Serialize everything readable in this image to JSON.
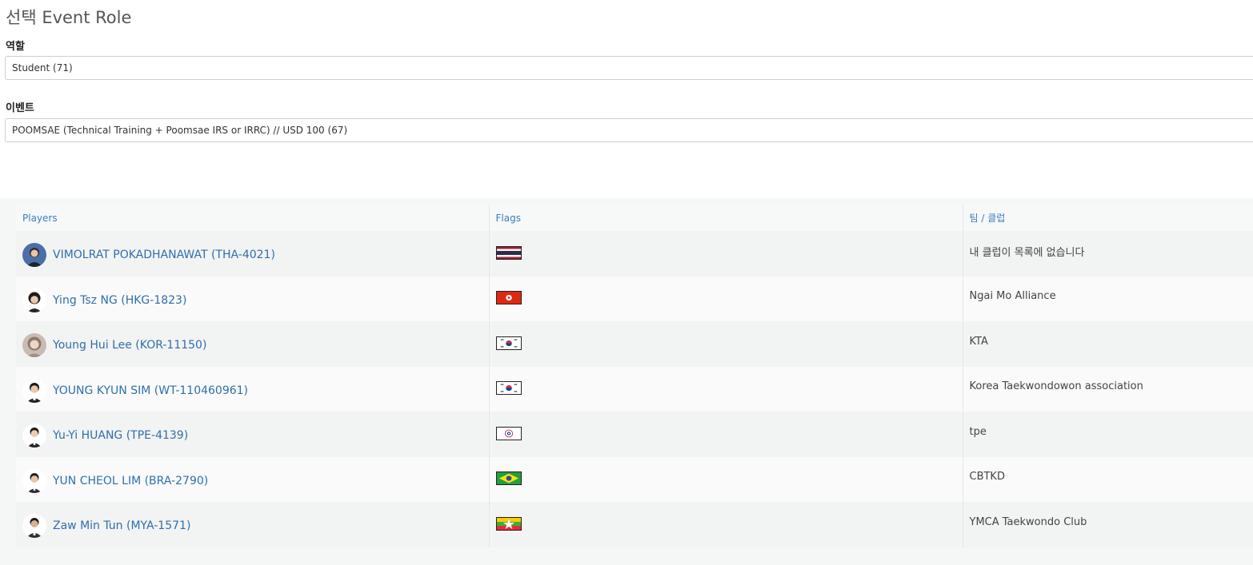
{
  "page": {
    "title": "선택 Event Role"
  },
  "form": {
    "role_label": "역할",
    "role_value": "Student (71)",
    "event_label": "이벤트",
    "event_value": "POOMSAE (Technical Training + Poomsae IRS or IRRC) // USD 100 (67)"
  },
  "table": {
    "headers": [
      "Players",
      "Flags",
      "팀 / 클럽"
    ],
    "rows": [
      {
        "player": "VIMOLRAT POKADHANAWAT (THA-4021)",
        "flag": "thailand-flag",
        "team": "내 클럽이 목록에 없습니다"
      },
      {
        "player": "Ying Tsz NG (HKG-1823)",
        "flag": "hong-kong-flag",
        "team": "Ngai Mo Alliance"
      },
      {
        "player": "Young Hui Lee (KOR-11150)",
        "flag": "south-korea-flag",
        "team": "KTA"
      },
      {
        "player": "YOUNG KYUN SIM (WT-110460961)",
        "flag": "south-korea-flag",
        "team": "Korea Taekwondowon association"
      },
      {
        "player": "Yu-Yi HUANG (TPE-4139)",
        "flag": "chinese-taipei-flag",
        "team": "tpe"
      },
      {
        "player": "YUN CHEOL LIM (BRA-2790)",
        "flag": "brazil-flag",
        "team": "CBTKD"
      },
      {
        "player": "Zaw Min Tun (MYA-1571)",
        "flag": "myanmar-flag",
        "team": "YMCA Taekwondo Club"
      }
    ]
  },
  "colors": {
    "link": "#2f6fab",
    "header_text": "#3a7ebd",
    "row_alt": "#f2f3f3"
  }
}
